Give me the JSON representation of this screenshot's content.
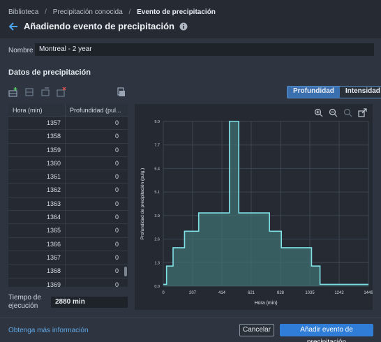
{
  "breadcrumb": {
    "items": [
      "Biblioteca",
      "Precipitación conocida",
      "Evento de precipitación"
    ],
    "separator": "/"
  },
  "title": "Añadiendo evento de precipitación",
  "form": {
    "name_label": "Nombre",
    "name_value": "Montreal - 2 year"
  },
  "section_title": "Datos de precipitación",
  "toolbar_icons": [
    "add-row-icon",
    "insert-row-icon",
    "delete-row-icon",
    "clear-table-icon",
    "paste-icon"
  ],
  "toggle": {
    "options": [
      "Profundidad",
      "Intensidad"
    ],
    "active": "Profundidad"
  },
  "table": {
    "columns": [
      "Hora (min)",
      "Profundidad (pul..."
    ],
    "rows": [
      [
        "1357",
        "0"
      ],
      [
        "1358",
        "0"
      ],
      [
        "1359",
        "0"
      ],
      [
        "1360",
        "0"
      ],
      [
        "1361",
        "0"
      ],
      [
        "1362",
        "0"
      ],
      [
        "1363",
        "0"
      ],
      [
        "1364",
        "0"
      ],
      [
        "1365",
        "0"
      ],
      [
        "1366",
        "0"
      ],
      [
        "1367",
        "0"
      ],
      [
        "1368",
        "0"
      ],
      [
        "1369",
        "0"
      ]
    ]
  },
  "execution": {
    "label": "Tiempo de ejecución",
    "value": "2880 min"
  },
  "chart_tools": [
    "zoom-in-icon",
    "zoom-out-icon",
    "zoom-reset-icon",
    "expand-icon"
  ],
  "chart_data": {
    "type": "area",
    "xlabel": "Hora (min)",
    "ylabel": "Profundidad de precipitación (pulg.)",
    "xlim": [
      0,
      1449
    ],
    "ylim": [
      0,
      9.0
    ],
    "x_ticks": [
      "0",
      "207",
      "414",
      "621",
      "828",
      "1035",
      "1242",
      "1449"
    ],
    "y_ticks": [
      "0.0",
      "1.3",
      "2.6",
      "3.9",
      "5.1",
      "6.4",
      "7.7",
      "9.0"
    ],
    "grid": true,
    "step_x": [
      0,
      23,
      69,
      150,
      250,
      393,
      467,
      533,
      624,
      750,
      834,
      933,
      1047,
      1107,
      1449
    ],
    "step_y": [
      0.1,
      1.1,
      2.1,
      3.0,
      4.0,
      4.0,
      9.0,
      4.0,
      4.0,
      3.0,
      2.1,
      2.1,
      1.1,
      0.1
    ],
    "colors": {
      "fill": "#3f6f72",
      "line": "#7fe0e6"
    }
  },
  "footer": {
    "more_info": "Obtenga más información",
    "cancel": "Cancelar",
    "add": "Añadir evento de precipitación"
  }
}
